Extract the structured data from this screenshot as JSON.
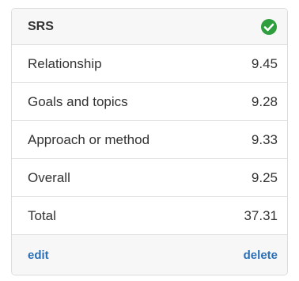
{
  "panel": {
    "title": "SRS",
    "status_icon": "check-circle-icon",
    "status_color": "#2e9e3e"
  },
  "rows": [
    {
      "label": "Relationship",
      "value": "9.45"
    },
    {
      "label": "Goals and topics",
      "value": "9.28"
    },
    {
      "label": "Approach or method",
      "value": "9.33"
    },
    {
      "label": "Overall",
      "value": "9.25"
    },
    {
      "label": "Total",
      "value": "37.31"
    }
  ],
  "actions": {
    "edit_label": "edit",
    "delete_label": "delete",
    "link_color": "#2a6fb6"
  }
}
